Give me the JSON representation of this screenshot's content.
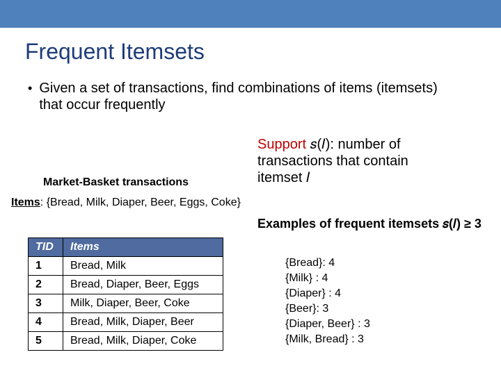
{
  "title": "Frequent Itemsets",
  "bullet": "Given a set of transactions, find combinations of items (itemsets) that occur frequently",
  "support": {
    "word": "Support",
    "s_of_i": "𝑠(𝐼):",
    "line1_rest": "  number of",
    "line2": "transactions that contain",
    "line3": "itemset 𝐼"
  },
  "mb_label": "Market-Basket transactions",
  "items_label": "Items",
  "items_list": ": {Bread, Milk, Diaper, Beer, Eggs, Coke}",
  "examples_prefix": "Examples of frequent itemsets ",
  "examples_cond": "𝑠(𝐼) ≥ 3",
  "chart_data": {
    "type": "table",
    "title": "Market-Basket transactions",
    "headers": [
      "TID",
      "Items"
    ],
    "rows": [
      [
        "1",
        "Bread, Milk"
      ],
      [
        "2",
        "Bread, Diaper, Beer, Eggs"
      ],
      [
        "3",
        "Milk, Diaper, Beer, Coke"
      ],
      [
        "4",
        "Bread, Milk, Diaper, Beer"
      ],
      [
        "5",
        "Bread, Milk, Diaper, Coke"
      ]
    ]
  },
  "freq": [
    "{Bread}: 4",
    "{Milk} : 4",
    "{Diaper} : 4",
    "{Beer}: 3",
    "{Diaper, Beer} : 3",
    "{Milk, Bread} : 3"
  ]
}
